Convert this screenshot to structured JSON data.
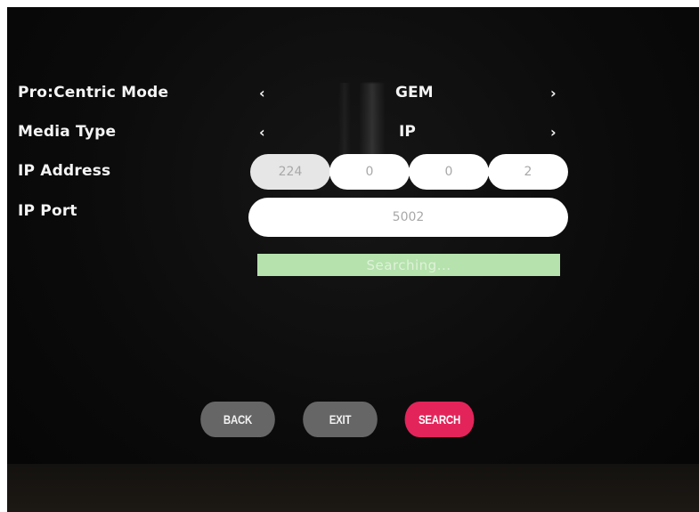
{
  "settings": {
    "rows": [
      {
        "label": "Pro:Centric Mode",
        "value": "GEM",
        "left_arrow": "‹",
        "right_arrow": "›"
      },
      {
        "label": "Media Type",
        "value": "IP",
        "left_arrow": "‹",
        "right_arrow": "›"
      },
      {
        "label": "IP Address"
      },
      {
        "label": "IP Port"
      }
    ],
    "ip_address": [
      "224",
      "0",
      "0",
      "2"
    ],
    "ip_port": "5002"
  },
  "status": {
    "text": "Searching...",
    "color": "#b5e2ad"
  },
  "buttons": {
    "back": "BACK",
    "exit": "EXIT",
    "search": "SEARCH",
    "accent_color": "#e3245a"
  },
  "icons": [
    "chevron-left-icon",
    "chevron-right-icon"
  ]
}
